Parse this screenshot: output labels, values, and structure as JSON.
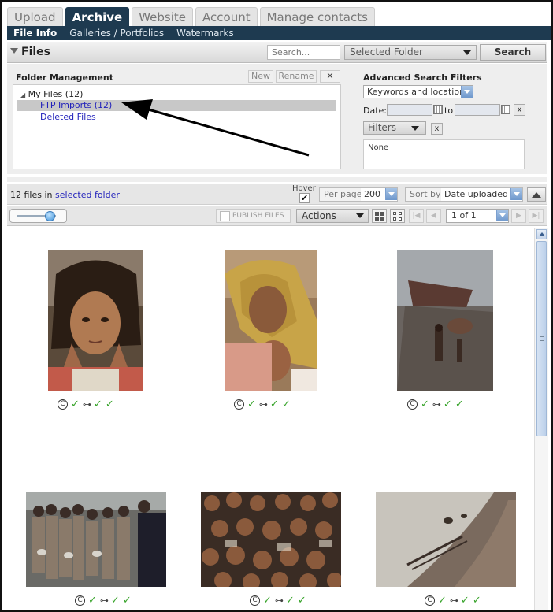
{
  "tabs": [
    {
      "label": "Upload",
      "active": false
    },
    {
      "label": "Archive",
      "active": true
    },
    {
      "label": "Website",
      "active": false
    },
    {
      "label": "Account",
      "active": false
    },
    {
      "label": "Manage contacts",
      "active": false
    }
  ],
  "subnav": [
    {
      "label": "File Info",
      "active": true
    },
    {
      "label": "Galleries / Portfolios",
      "active": false
    },
    {
      "label": "Watermarks",
      "active": false
    }
  ],
  "files_header": {
    "title": "Files",
    "search_placeholder": "Search...",
    "folder_select": "Selected Folder",
    "search_button": "Search"
  },
  "folder_management": {
    "title": "Folder Management",
    "new_button": "New",
    "rename_button": "Rename",
    "close_button": "✕",
    "tree": {
      "root": "My Files (12)",
      "items": [
        {
          "label": "FTP Imports (12)",
          "selected": true
        },
        {
          "label": "Deleted Files",
          "selected": false
        }
      ]
    }
  },
  "advanced_search": {
    "title": "Advanced Search Filters",
    "keyword_select": "Keywords and location",
    "date_label": "Date:",
    "to_label": "to",
    "clear_label": "x",
    "filters_button": "Filters",
    "filters_value": "None"
  },
  "results": {
    "count": "12 files in",
    "folder_link": "selected folder",
    "hover_label": "Hover",
    "hover_checked": "✔",
    "per_page_label": "Per page",
    "per_page_value": "200",
    "sort_label": "Sort by",
    "sort_value": "Date uploaded"
  },
  "toolbar": {
    "publish_label": "PUBLISH FILES",
    "actions_label": "Actions",
    "page_value": "1 of 1",
    "slider_level": 0.8
  },
  "icons": {
    "copyright": "C",
    "check": "✓",
    "key": "⊶"
  },
  "colors": {
    "nav_dark": "#1e3a50",
    "link": "#2222bb",
    "check_green": "#3aa52d"
  }
}
